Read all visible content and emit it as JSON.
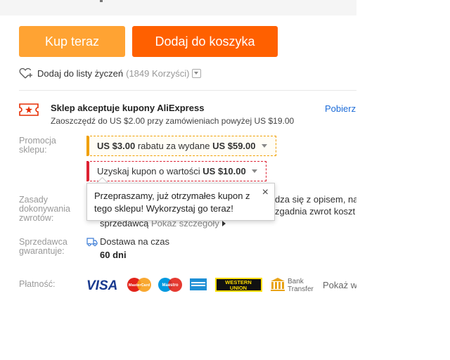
{
  "actions": {
    "buy_now": "Kup teraz",
    "add_to_cart": "Dodaj do koszyka"
  },
  "wishlist": {
    "label": "Dodaj do listy życzeń",
    "count": "(1849 Korzyści)"
  },
  "store_coupons": {
    "title": "Sklep akceptuje kupony AliExpress",
    "subtitle": "Zaoszczędź do US $2.00 przy zamówieniach powyżej US $19.00",
    "get_link": "Pobierz"
  },
  "promotion": {
    "label": "Promocja sklepu:",
    "discount_amount": "US $3.00",
    "discount_text": " rabatu za wydane ",
    "discount_threshold": "US $59.00",
    "coupon_text": "Uzyskaj kupon o wartości ",
    "coupon_amount": "US $10.00"
  },
  "tooltip": {
    "line1": "Przepraszamy, już otrzymałes kupon z",
    "line2": "tego sklepu! Wykorzystaj go teraz!",
    "close": "×"
  },
  "returns": {
    "label": "Zasady dokonywania zwrotów:",
    "line1_tail": "dza się z opisem, nal",
    "line2_tail": "zgadnia zwrot koszt",
    "line3_seller": "sprzedawcą",
    "line3_link": "Pokaż szczegóły"
  },
  "guarantee": {
    "label": "Sprzedawca gwarantuje:",
    "delivery": "Dostawa na czas",
    "days": "60 dni"
  },
  "payment": {
    "label": "Płatność:",
    "methods": [
      "VISA",
      "MasterCard",
      "Maestro",
      "American Express",
      "WESTERN UNION",
      "Bank Transfer"
    ],
    "visa": "VISA",
    "mastercard": "MasterCard",
    "maestro": "Maestro",
    "western_line1": "WESTERN",
    "western_line2": "UNION",
    "bank_line1": "Bank",
    "bank_line2": "Transfer",
    "show_link": "Pokaż w"
  },
  "colors": {
    "buy": "#ffa333",
    "cart": "#ff6000",
    "link": "#1b6bd8",
    "promo_border": "#f0a000",
    "coupon_border": "#dd2233"
  }
}
